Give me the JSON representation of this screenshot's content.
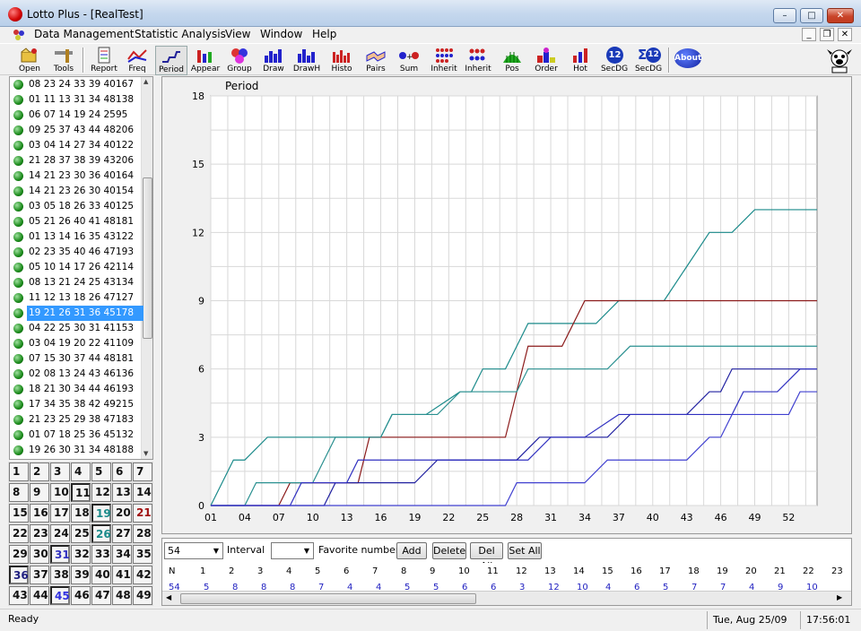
{
  "window": {
    "title": "Lotto Plus - [RealTest]",
    "min": "–",
    "max": "□",
    "close": "✕",
    "mdi_min": "_",
    "mdi_restore": "❐",
    "mdi_close": "✕"
  },
  "menu": {
    "items": [
      "Data Management",
      "Statistic Analysis",
      "View",
      "Window",
      "Help"
    ]
  },
  "toolbar": {
    "buttons": [
      {
        "label": "Open",
        "icon": "open-icon"
      },
      {
        "label": "Tools",
        "icon": "tools-icon"
      },
      {
        "label": "Report",
        "icon": "report-icon"
      },
      {
        "label": "Freq",
        "icon": "freq-icon"
      },
      {
        "label": "Period",
        "icon": "period-icon"
      },
      {
        "label": "Appear",
        "icon": "appear-icon"
      },
      {
        "label": "Group",
        "icon": "group-icon"
      },
      {
        "label": "Draw",
        "icon": "draw-icon"
      },
      {
        "label": "DrawH",
        "icon": "drawh-icon"
      },
      {
        "label": "Histo",
        "icon": "histo-icon"
      },
      {
        "label": "Pairs",
        "icon": "pairs-icon"
      },
      {
        "label": "Sum",
        "icon": "sum-icon"
      },
      {
        "label": "Inherit",
        "icon": "inherit-icon"
      },
      {
        "label": "Inherit",
        "icon": "inherit2-icon"
      },
      {
        "label": "Pos",
        "icon": "pos-icon"
      },
      {
        "label": "Order",
        "icon": "order-icon"
      },
      {
        "label": "Hot",
        "icon": "hot-icon"
      },
      {
        "label": "SecDG",
        "icon": "secdg-icon"
      },
      {
        "label": "SecDG",
        "icon": "sumsecdg-icon"
      },
      {
        "label": "About",
        "icon": "about-icon"
      }
    ],
    "about_text": "About",
    "secdg_badge": "12",
    "sum_symbol": "Σ"
  },
  "draws": [
    {
      "n": "08 23 24 33 39 40",
      "s": "167"
    },
    {
      "n": "01 11 13 31 34 48",
      "s": "138"
    },
    {
      "n": "06 07 14 19 24 25",
      "s": "95"
    },
    {
      "n": "09 25 37 43 44 48",
      "s": "206"
    },
    {
      "n": "03 04 14 27 34 40",
      "s": "122"
    },
    {
      "n": "21 28 37 38 39 43",
      "s": "206"
    },
    {
      "n": "14 21 23 30 36 40",
      "s": "164"
    },
    {
      "n": "14 21 23 26 30 40",
      "s": "154"
    },
    {
      "n": "03 05 18 26 33 40",
      "s": "125"
    },
    {
      "n": "05 21 26 40 41 48",
      "s": "181"
    },
    {
      "n": "01 13 14 16 35 43",
      "s": "122"
    },
    {
      "n": "02 23 35 40 46 47",
      "s": "193"
    },
    {
      "n": "05 10 14 17 26 42",
      "s": "114"
    },
    {
      "n": "08 13 21 24 25 43",
      "s": "134"
    },
    {
      "n": "11 12 13 18 26 47",
      "s": "127"
    },
    {
      "n": "19 21 26 31 36 45",
      "s": "178"
    },
    {
      "n": "04 22 25 30 31 41",
      "s": "153"
    },
    {
      "n": "03 04 19 20 22 41",
      "s": "109"
    },
    {
      "n": "07 15 30 37 44 48",
      "s": "181"
    },
    {
      "n": "02 08 13 24 43 46",
      "s": "136"
    },
    {
      "n": "18 21 30 34 44 46",
      "s": "193"
    },
    {
      "n": "17 34 35 38 42 49",
      "s": "215"
    },
    {
      "n": "21 23 25 29 38 47",
      "s": "183"
    },
    {
      "n": "01 07 18 25 36 45",
      "s": "132"
    },
    {
      "n": "19 26 30 31 34 48",
      "s": "188"
    }
  ],
  "selected_index": 15,
  "numbers": [
    1,
    2,
    3,
    4,
    5,
    6,
    7,
    8,
    9,
    10,
    11,
    12,
    13,
    14,
    15,
    16,
    17,
    18,
    19,
    20,
    21,
    22,
    23,
    24,
    25,
    26,
    27,
    28,
    29,
    30,
    31,
    32,
    33,
    34,
    35,
    36,
    37,
    38,
    39,
    40,
    41,
    42,
    43,
    44,
    45,
    46,
    47,
    48,
    49
  ],
  "number_colors": {
    "19": "#1a8a8a",
    "21": "#a01010",
    "26": "#1a8a8a",
    "31": "#3030c0",
    "36": "#202080",
    "45": "#3030e0"
  },
  "chart_data": {
    "type": "line",
    "title": "Period",
    "x_ticks": [
      "01",
      "04",
      "07",
      "10",
      "13",
      "16",
      "19",
      "22",
      "25",
      "28",
      "31",
      "34",
      "37",
      "40",
      "43",
      "46",
      "49",
      "52"
    ],
    "y_ticks": [
      "0",
      "3",
      "6",
      "9",
      "12",
      "15",
      "18"
    ],
    "xlim": [
      1,
      54.5
    ],
    "ylim": [
      0,
      18
    ],
    "grid": true,
    "series": [
      {
        "color": "#1a8a8a",
        "points": [
          [
            1,
            0
          ],
          [
            2,
            1
          ],
          [
            3,
            2
          ],
          [
            4,
            2
          ],
          [
            6,
            3
          ],
          [
            16,
            3
          ],
          [
            17,
            4
          ],
          [
            20,
            4
          ],
          [
            23,
            5
          ],
          [
            24,
            5
          ],
          [
            25,
            6
          ],
          [
            27,
            6
          ],
          [
            29,
            8
          ],
          [
            35,
            8
          ],
          [
            37,
            9
          ],
          [
            41,
            9
          ],
          [
            45,
            12
          ],
          [
            47,
            12
          ],
          [
            49,
            13
          ],
          [
            55,
            13
          ]
        ]
      },
      {
        "color": "#8b1a1a",
        "points": [
          [
            1,
            0
          ],
          [
            7,
            0
          ],
          [
            8,
            1
          ],
          [
            14,
            1
          ],
          [
            15,
            3
          ],
          [
            27,
            3
          ],
          [
            29,
            7
          ],
          [
            32,
            7
          ],
          [
            34,
            9
          ],
          [
            55,
            9
          ]
        ]
      },
      {
        "color": "#2a9090",
        "points": [
          [
            1,
            0
          ],
          [
            4,
            0
          ],
          [
            5,
            1
          ],
          [
            10,
            1
          ],
          [
            12,
            3
          ],
          [
            16,
            3
          ],
          [
            17,
            4
          ],
          [
            21,
            4
          ],
          [
            23,
            5
          ],
          [
            24,
            5
          ],
          [
            26,
            5
          ],
          [
            28,
            5
          ],
          [
            29,
            6
          ],
          [
            36,
            6
          ],
          [
            38,
            7
          ],
          [
            55,
            7
          ]
        ]
      },
      {
        "color": "#2020a0",
        "points": [
          [
            1,
            0
          ],
          [
            11,
            0
          ],
          [
            12,
            1
          ],
          [
            19,
            1
          ],
          [
            21,
            2
          ],
          [
            28,
            2
          ],
          [
            30,
            3
          ],
          [
            36,
            3
          ],
          [
            38,
            4
          ],
          [
            43,
            4
          ],
          [
            45,
            5
          ],
          [
            46,
            5
          ],
          [
            47,
            6
          ],
          [
            55,
            6
          ]
        ]
      },
      {
        "color": "#3030c0",
        "points": [
          [
            1,
            0
          ],
          [
            8,
            0
          ],
          [
            9,
            1
          ],
          [
            13,
            1
          ],
          [
            14,
            2
          ],
          [
            21,
            2
          ],
          [
            28,
            2
          ],
          [
            29,
            2
          ],
          [
            31,
            3
          ],
          [
            34,
            3
          ],
          [
            37,
            4
          ],
          [
            45,
            4
          ],
          [
            47,
            4
          ],
          [
            48,
            5
          ],
          [
            51,
            5
          ],
          [
            53,
            6
          ],
          [
            55,
            6
          ]
        ]
      },
      {
        "color": "#4040d0",
        "points": [
          [
            1,
            0
          ],
          [
            27,
            0
          ],
          [
            28,
            1
          ],
          [
            34,
            1
          ],
          [
            36,
            2
          ],
          [
            43,
            2
          ],
          [
            45,
            3
          ],
          [
            46,
            3
          ],
          [
            47,
            4
          ],
          [
            52,
            4
          ],
          [
            53,
            5
          ],
          [
            55,
            5
          ]
        ]
      }
    ]
  },
  "bottom": {
    "interval_value": "54",
    "interval_label": "Interval",
    "favorite_label": "Favorite numbers",
    "btn_add": "Add",
    "btn_delete": "Delete",
    "btn_delall": "Del All",
    "btn_setall": "Set All",
    "headers": [
      "N",
      "1",
      "2",
      "3",
      "4",
      "5",
      "6",
      "7",
      "8",
      "9",
      "10",
      "11",
      "12",
      "13",
      "14",
      "15",
      "16",
      "17",
      "18",
      "19",
      "20",
      "21",
      "22",
      "23"
    ],
    "values": [
      "54",
      "5",
      "8",
      "8",
      "8",
      "7",
      "4",
      "4",
      "5",
      "5",
      "6",
      "6",
      "3",
      "12",
      "10",
      "4",
      "6",
      "5",
      "7",
      "7",
      "4",
      "9",
      "10"
    ]
  },
  "status": {
    "left": "Ready",
    "date": "Tue, Aug 25/09",
    "time": "17:56:01"
  }
}
